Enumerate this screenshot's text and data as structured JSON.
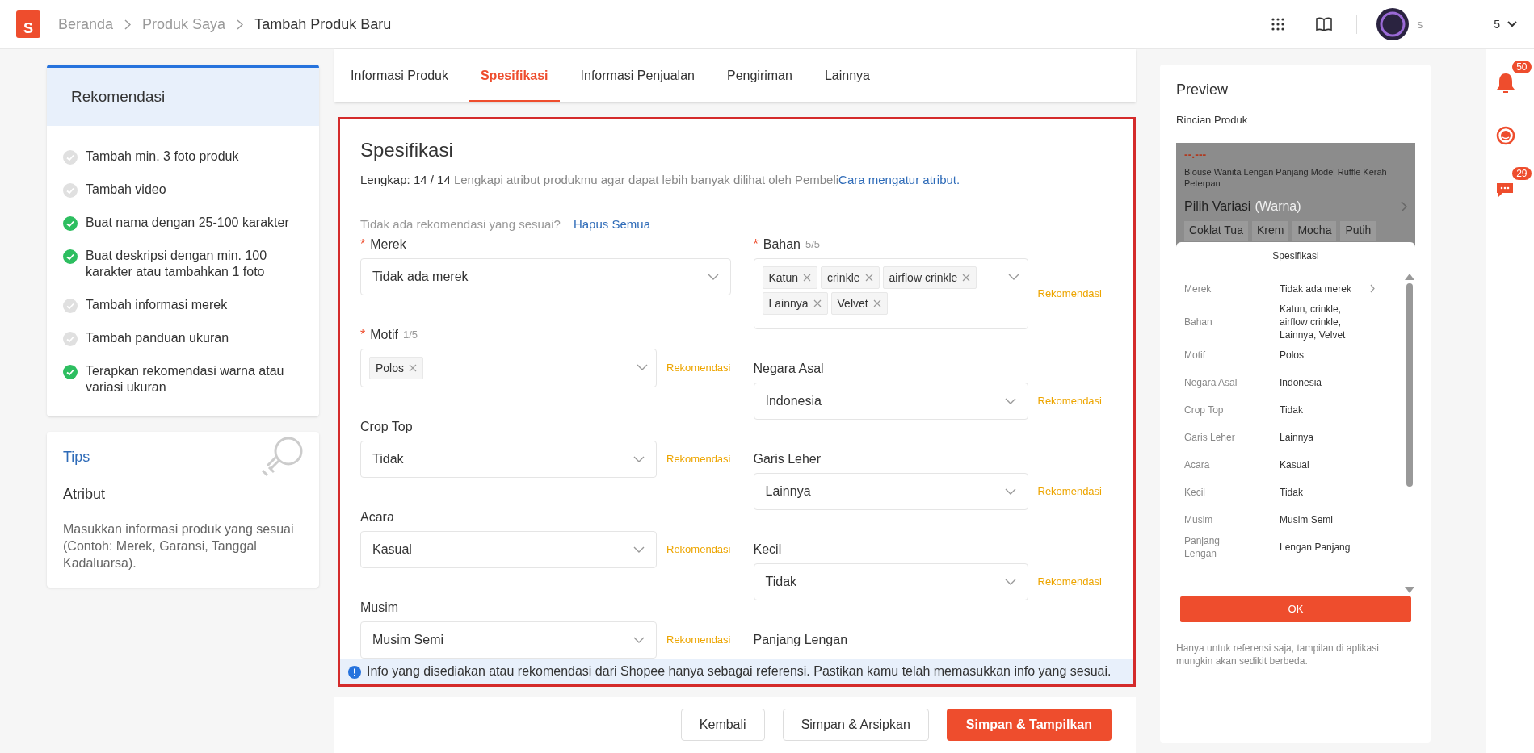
{
  "header": {
    "logo_letter": "S",
    "breadcrumbs": [
      {
        "label": "Beranda",
        "current": false
      },
      {
        "label": "Produk Saya",
        "current": false
      },
      {
        "label": "Tambah Produk Baru",
        "current": true
      }
    ],
    "user_parts": [
      "s",
      "5"
    ]
  },
  "recommendations": {
    "title": "Rekomendasi",
    "items": [
      {
        "text": "Tambah min. 3 foto produk",
        "done": false
      },
      {
        "text": "Tambah video",
        "done": false
      },
      {
        "text": "Buat nama dengan 25-100 karakter",
        "done": true
      },
      {
        "text": "Buat deskripsi dengan min. 100 karakter atau tambahkan 1 foto",
        "done": true
      },
      {
        "text": "Tambah informasi merek",
        "done": false
      },
      {
        "text": "Tambah panduan ukuran",
        "done": false
      },
      {
        "text": "Terapkan rekomendasi warna atau variasi ukuran",
        "done": true
      }
    ]
  },
  "tips": {
    "label": "Tips",
    "title": "Atribut",
    "text": "Masukkan informasi produk yang sesuai (Contoh: Merek, Garansi, Tanggal Kadaluarsa)."
  },
  "tabs": [
    {
      "label": "Informasi Produk",
      "selected": false
    },
    {
      "label": "Spesifikasi",
      "selected": true
    },
    {
      "label": "Informasi Penjualan",
      "selected": false
    },
    {
      "label": "Pengiriman",
      "selected": false
    },
    {
      "label": "Lainnya",
      "selected": false
    }
  ],
  "spec": {
    "title": "Spesifikasi",
    "required_mark": "*",
    "progress": "Lengkap: 14 / 14",
    "hint": "Lengkapi atribut produkmu agar dapat lebih banyak dilihat oleh Pembeli",
    "help_link": "Cara mengatur atribut.",
    "no_match": "Tidak ada rekomendasi yang sesuai?",
    "clear_all": "Hapus Semua",
    "columns": [
      [
        {
          "label": "Merek",
          "required": true,
          "kind": "select",
          "value": "Tidak ada merek",
          "wide": true
        },
        {
          "label": "Motif",
          "required": true,
          "count": "1/5",
          "kind": "tags",
          "tags": [
            "Polos"
          ],
          "recommend": "Rekomendasi"
        },
        {
          "label": "Crop Top",
          "required": false,
          "kind": "select",
          "value": "Tidak",
          "recommend": "Rekomendasi"
        },
        {
          "label": "Acara",
          "required": false,
          "kind": "select",
          "value": "Kasual",
          "recommend": "Rekomendasi"
        },
        {
          "label": "Musim",
          "required": false,
          "kind": "select",
          "value": "Musim Semi",
          "recommend": "Rekomendasi"
        }
      ],
      [
        {
          "label": "Bahan",
          "required": true,
          "count": "5/5",
          "kind": "tags",
          "tags": [
            "Katun",
            "crinkle",
            "airflow crinkle",
            "Lainnya",
            "Velvet"
          ],
          "recommend": "Rekomendasi"
        },
        {
          "label": "Negara Asal",
          "required": false,
          "kind": "select",
          "value": "Indonesia",
          "recommend": "Rekomendasi"
        },
        {
          "label": "Garis Leher",
          "required": false,
          "kind": "select",
          "value": "Lainnya",
          "recommend": "Rekomendasi"
        },
        {
          "label": "Kecil",
          "required": false,
          "kind": "select",
          "value": "Tidak",
          "recommend": "Rekomendasi"
        },
        {
          "label": "Panjang Lengan",
          "required": false,
          "kind": "select"
        }
      ]
    ],
    "info": "Info yang disediakan atau rekomendasi dari Shopee hanya sebagai referensi. Pastikan kamu telah memasukkan info yang sesuai."
  },
  "buttons": [
    {
      "label": "Kembali",
      "kind": "secondary"
    },
    {
      "label": "Simpan & Arsipkan",
      "kind": "secondary"
    },
    {
      "label": "Simpan & Tampilkan",
      "kind": "primary"
    }
  ],
  "preview": {
    "title": "Preview",
    "subtitle": "Rincian Produk",
    "price": "--.---",
    "product_name": "Blouse Wanita Lengan Panjang Model Ruffle Kerah Peterpan",
    "variation_label": "Pilih Variasi",
    "variation_hint": "(Warna)",
    "variations": [
      "Coklat Tua",
      "Krem",
      "Mocha",
      "Putih"
    ],
    "sheet_title": "Spesifikasi",
    "rows": [
      {
        "label": "Merek",
        "value": "Tidak ada merek",
        "link": true
      },
      {
        "label": "Bahan",
        "value": "Katun, crinkle, airflow crinkle, Lainnya, Velvet",
        "link": false
      },
      {
        "label": "Motif",
        "value": "Polos",
        "link": false
      },
      {
        "label": "Negara Asal",
        "value": "Indonesia",
        "link": false
      },
      {
        "label": "Crop Top",
        "value": "Tidak",
        "link": false
      },
      {
        "label": "Garis Leher",
        "value": "Lainnya",
        "link": false
      },
      {
        "label": "Acara",
        "value": "Kasual",
        "link": false
      },
      {
        "label": "Kecil",
        "value": "Tidak",
        "link": false
      },
      {
        "label": "Musim",
        "value": "Musim Semi",
        "link": false
      },
      {
        "label": "Panjang Lengan",
        "value": "Lengan Panjang",
        "link": false
      }
    ],
    "ok": "OK",
    "note": "Hanya untuk referensi saja, tampilan di aplikasi mungkin akan sedikit berbeda."
  },
  "side_icons": [
    {
      "kind": "bell",
      "badge": "50"
    },
    {
      "kind": "headset"
    },
    {
      "kind": "chat",
      "badge": "29"
    }
  ]
}
